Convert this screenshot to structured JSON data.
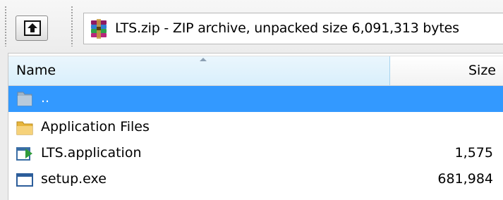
{
  "toolbar": {
    "archive_info": "LTS.zip - ZIP archive, unpacked size 6,091,313 bytes"
  },
  "list": {
    "columns": {
      "name": "Name",
      "size": "Size"
    },
    "rows": [
      {
        "name": "..",
        "size": "",
        "icon": "parent-folder-icon",
        "selected": true
      },
      {
        "name": "Application Files",
        "size": "",
        "icon": "folder-icon",
        "selected": false
      },
      {
        "name": "LTS.application",
        "size": "1,575",
        "icon": "application-manifest-icon",
        "selected": false
      },
      {
        "name": "setup.exe",
        "size": "681,984",
        "icon": "executable-icon",
        "selected": false
      }
    ]
  },
  "colors": {
    "selection": "#3399ff",
    "header_sorted": "#d9effb"
  }
}
